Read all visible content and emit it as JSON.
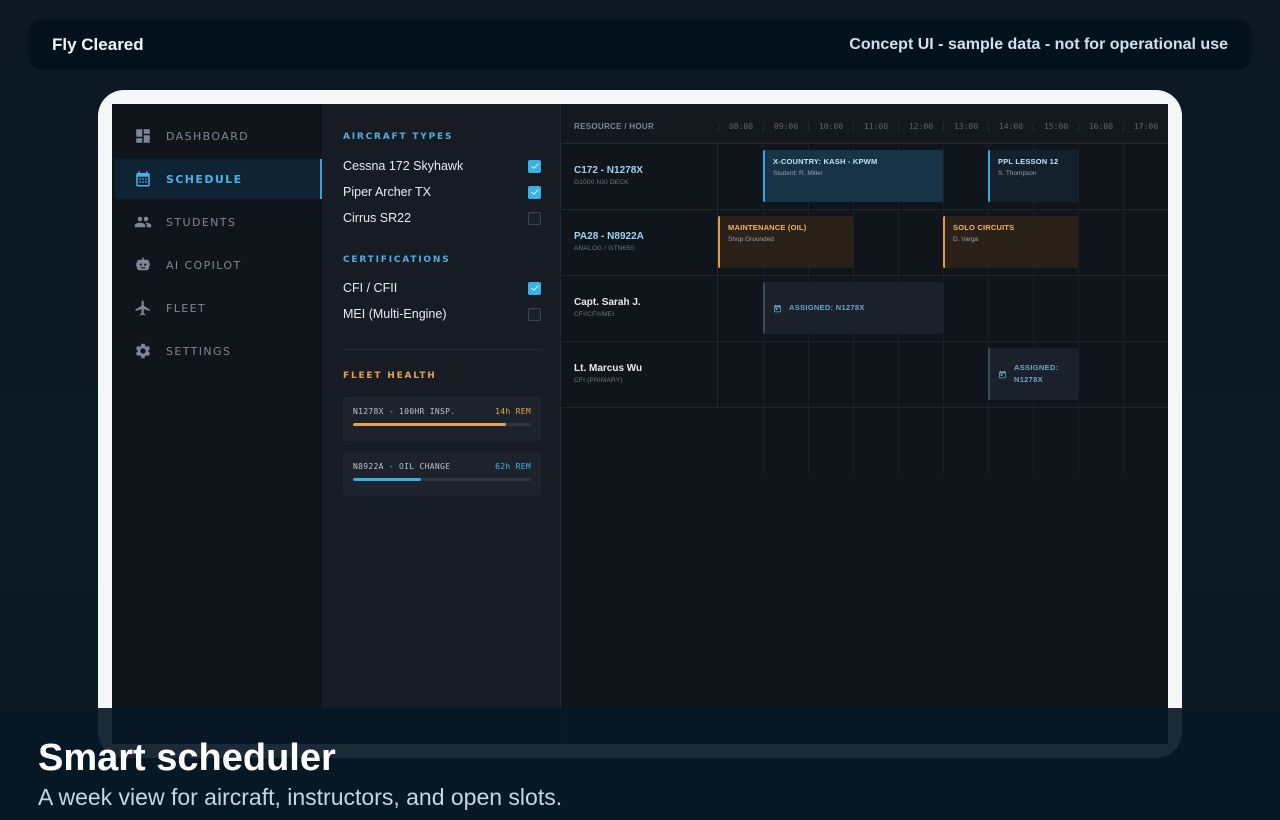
{
  "header": {
    "brand": "Fly Cleared",
    "disclaimer": "Concept UI - sample data - not for operational use"
  },
  "sidebar": {
    "items": [
      {
        "label": "DASHBOARD",
        "icon": "dashboard-icon"
      },
      {
        "label": "SCHEDULE",
        "icon": "calendar-icon",
        "active": true
      },
      {
        "label": "STUDENTS",
        "icon": "people-icon"
      },
      {
        "label": "AI COPILOT",
        "icon": "robot-icon"
      },
      {
        "label": "FLEET",
        "icon": "airplane-icon"
      },
      {
        "label": "SETTINGS",
        "icon": "gear-icon"
      }
    ]
  },
  "filters": {
    "aircraft_title": "AIRCRAFT TYPES",
    "aircraft": [
      {
        "label": "Cessna 172 Skyhawk",
        "checked": true
      },
      {
        "label": "Piper Archer TX",
        "checked": true
      },
      {
        "label": "Cirrus SR22",
        "checked": false
      }
    ],
    "cert_title": "CERTIFICATIONS",
    "certs": [
      {
        "label": "CFI / CFII",
        "checked": true
      },
      {
        "label": "MEI (Multi-Engine)",
        "checked": false
      }
    ],
    "health_title": "FLEET HEALTH",
    "health": [
      {
        "label": "N1278X - 100HR INSP.",
        "remaining": "14h REM",
        "progress": 0.86,
        "color": "#e9a04a"
      },
      {
        "label": "N8922A - OIL CHANGE",
        "remaining": "62h REM",
        "progress": 0.38,
        "color": "#3ab0e6"
      }
    ]
  },
  "schedule": {
    "header_label": "RESOURCE / HOUR",
    "hours": [
      "08:00",
      "09:00",
      "10:00",
      "11:00",
      "12:00",
      "13:00",
      "14:00",
      "15:00",
      "16:00",
      "17:00"
    ],
    "rows": [
      {
        "name": "C172 - N1278X",
        "sub": "G1000 NXI DECK",
        "events": [
          {
            "title": "X-COUNTRY: KASH - KPWM",
            "sub": "Student: R. Miller",
            "style": "blue"
          },
          {
            "title": "PPL LESSON 12",
            "sub": "S. Thompson",
            "style": "dark"
          }
        ]
      },
      {
        "name": "PA28 - N8922A",
        "sub": "ANALOG / GTN650",
        "events": [
          {
            "title": "MAINTENANCE (OIL)",
            "sub": "Shop Grounded",
            "style": "orange"
          },
          {
            "title": "SOLO CIRCUITS",
            "sub": "D. Varga",
            "style": "orange"
          }
        ]
      },
      {
        "name": "Capt. Sarah J.",
        "sub": "CFI/CFII/MEI",
        "events": [
          {
            "title": "ASSIGNED: N1278X",
            "style": "gray"
          }
        ]
      },
      {
        "name": "Lt. Marcus Wu",
        "sub": "CFI (PRIMARY)",
        "events": [
          {
            "title": "ASSIGNED: N1278X",
            "style": "gray"
          }
        ]
      }
    ]
  },
  "footer": {
    "headline": "Smart scheduler",
    "subhead": "A week view for aircraft, instructors, and open slots."
  }
}
